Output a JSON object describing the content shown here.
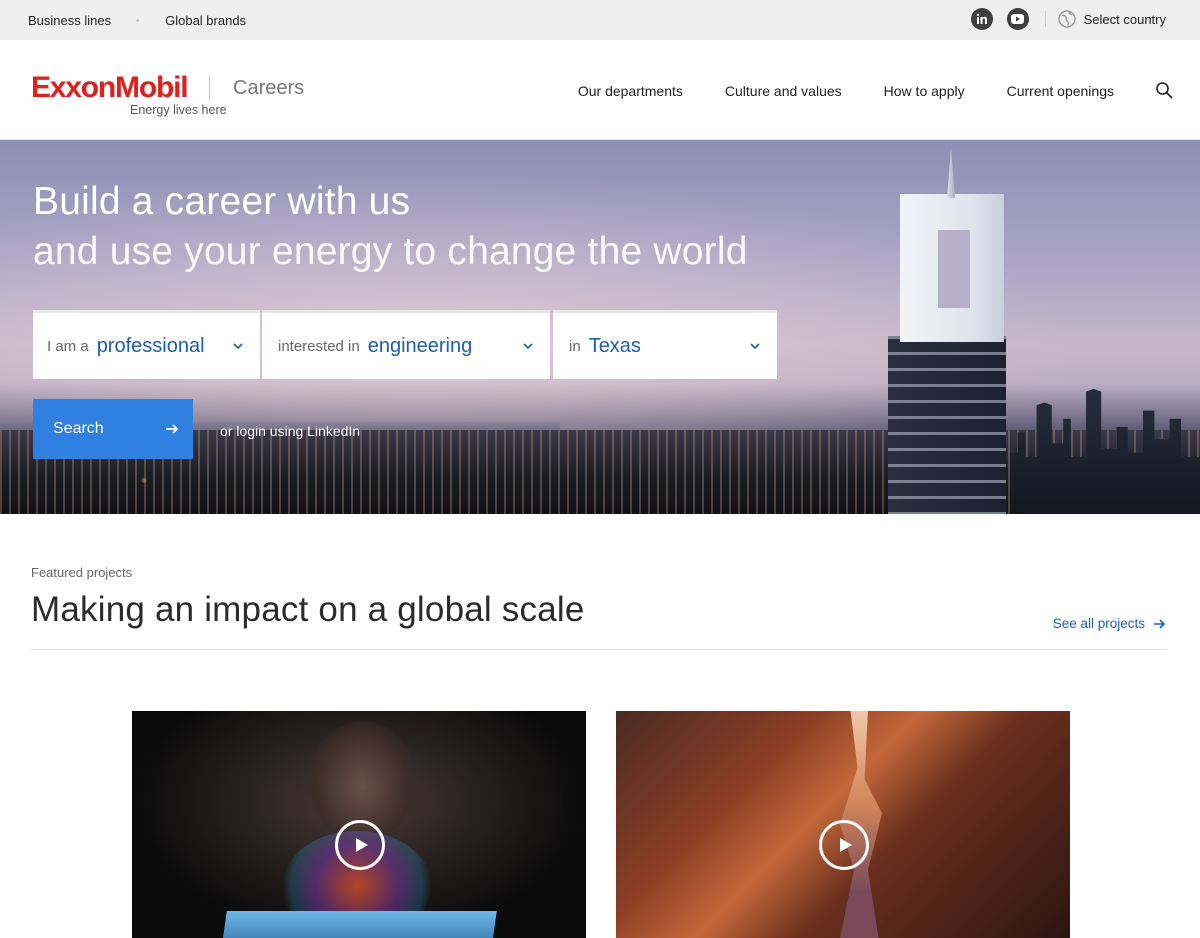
{
  "utility": {
    "links": [
      "Business lines",
      "Global brands"
    ],
    "social": [
      "linkedin-icon",
      "youtube-icon"
    ],
    "country_label": "Select country"
  },
  "header": {
    "logo_word": "ExxonMobil",
    "logo_tagline": "Energy lives here",
    "section_label": "Careers",
    "nav": [
      "Our departments",
      "Culture and values",
      "How to apply",
      "Current openings"
    ]
  },
  "hero": {
    "title_line1": "Build a career with us",
    "title_line2": "and use your energy to change the world",
    "filters": [
      {
        "label": "I am a",
        "value": "professional"
      },
      {
        "label": "interested in",
        "value": "engineering"
      },
      {
        "label": "in",
        "value": "Texas"
      }
    ],
    "search_label": "Search",
    "linkedin_text": "or login using LinkedIn"
  },
  "featured": {
    "eyebrow": "Featured projects",
    "title": "Making an impact on a global scale",
    "see_all": "See all projects"
  },
  "colors": {
    "brand_red": "#e0201e",
    "link_blue": "#1a5fb4",
    "button_blue": "#2f80e0"
  }
}
